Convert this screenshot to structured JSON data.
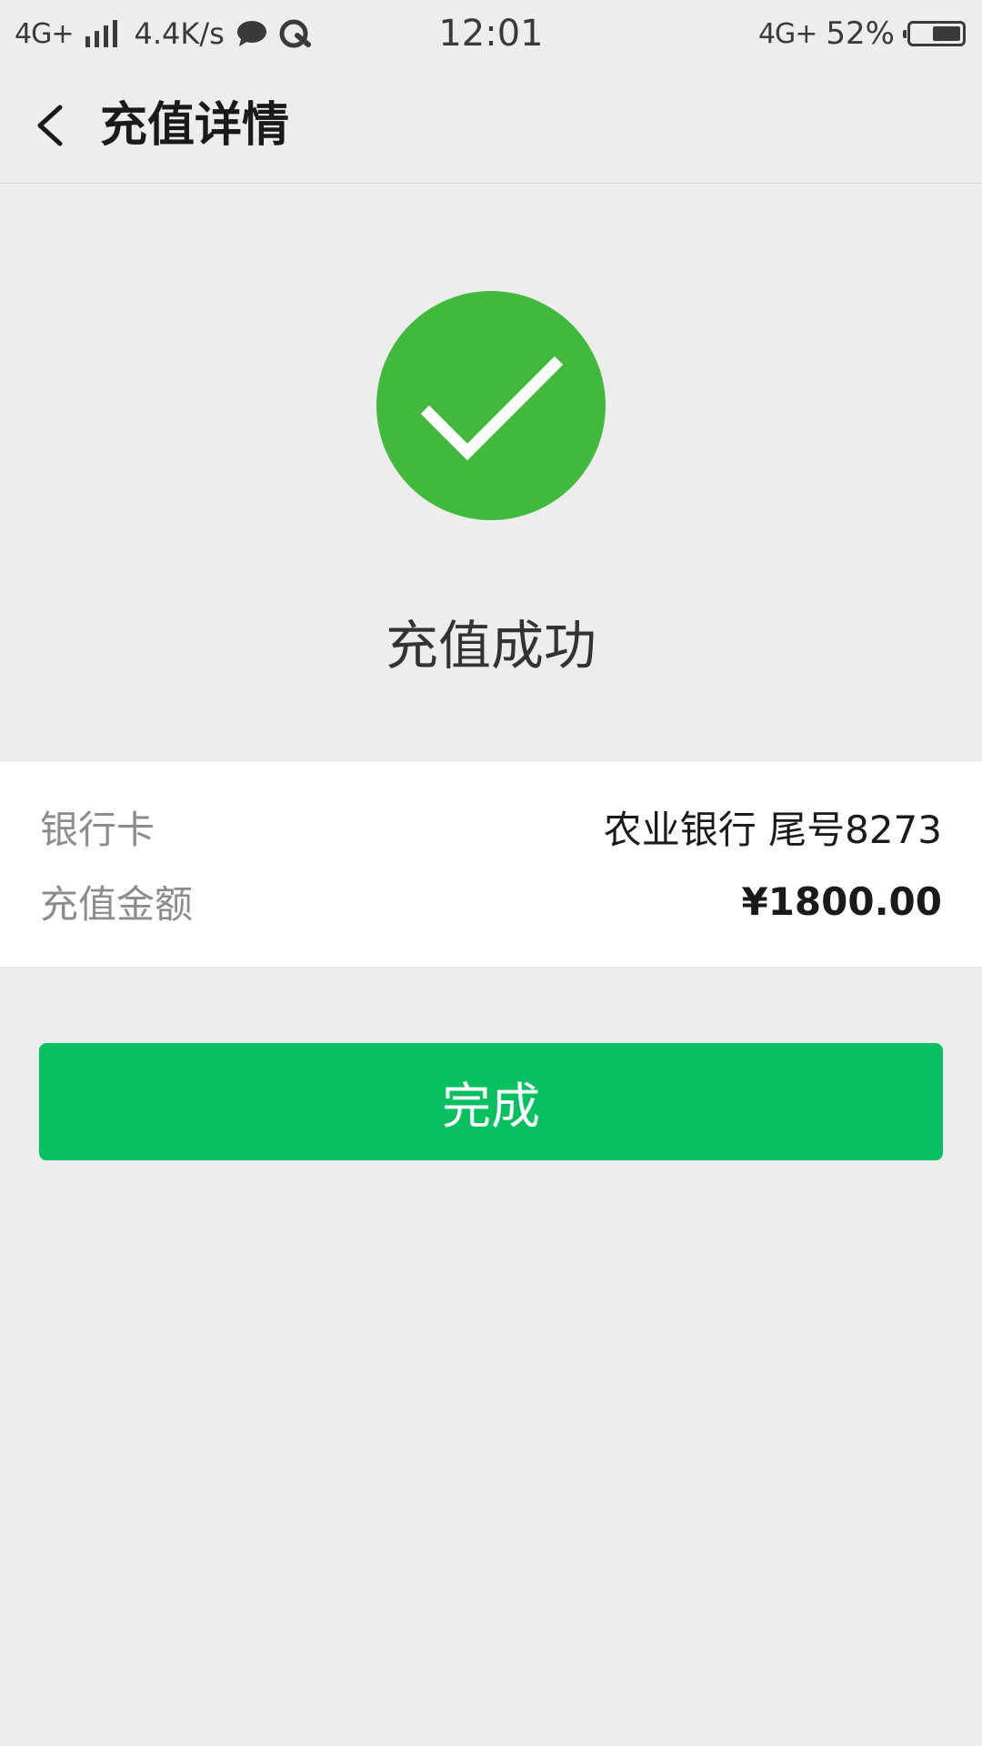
{
  "status_bar": {
    "network_left": "4G+",
    "speed": "4.4K/s",
    "time": "12:01",
    "network_right": "4G+",
    "battery_percent_text": "52%",
    "battery_level": 0.52,
    "icons": [
      "signal-bars-icon",
      "chat-bubble-icon",
      "qq-icon",
      "battery-icon"
    ]
  },
  "nav": {
    "title": "充值详情",
    "back_icon": "chevron-left-icon"
  },
  "result": {
    "icon": "success-check-icon",
    "icon_color": "#40b93c",
    "title": "充值成功"
  },
  "details": {
    "bank_card_label": "银行卡",
    "bank_card_value": "农业银行 尾号8273",
    "amount_label": "充值金额",
    "amount_value": "¥1800.00"
  },
  "actions": {
    "done_label": "完成",
    "done_color": "#07c160"
  }
}
